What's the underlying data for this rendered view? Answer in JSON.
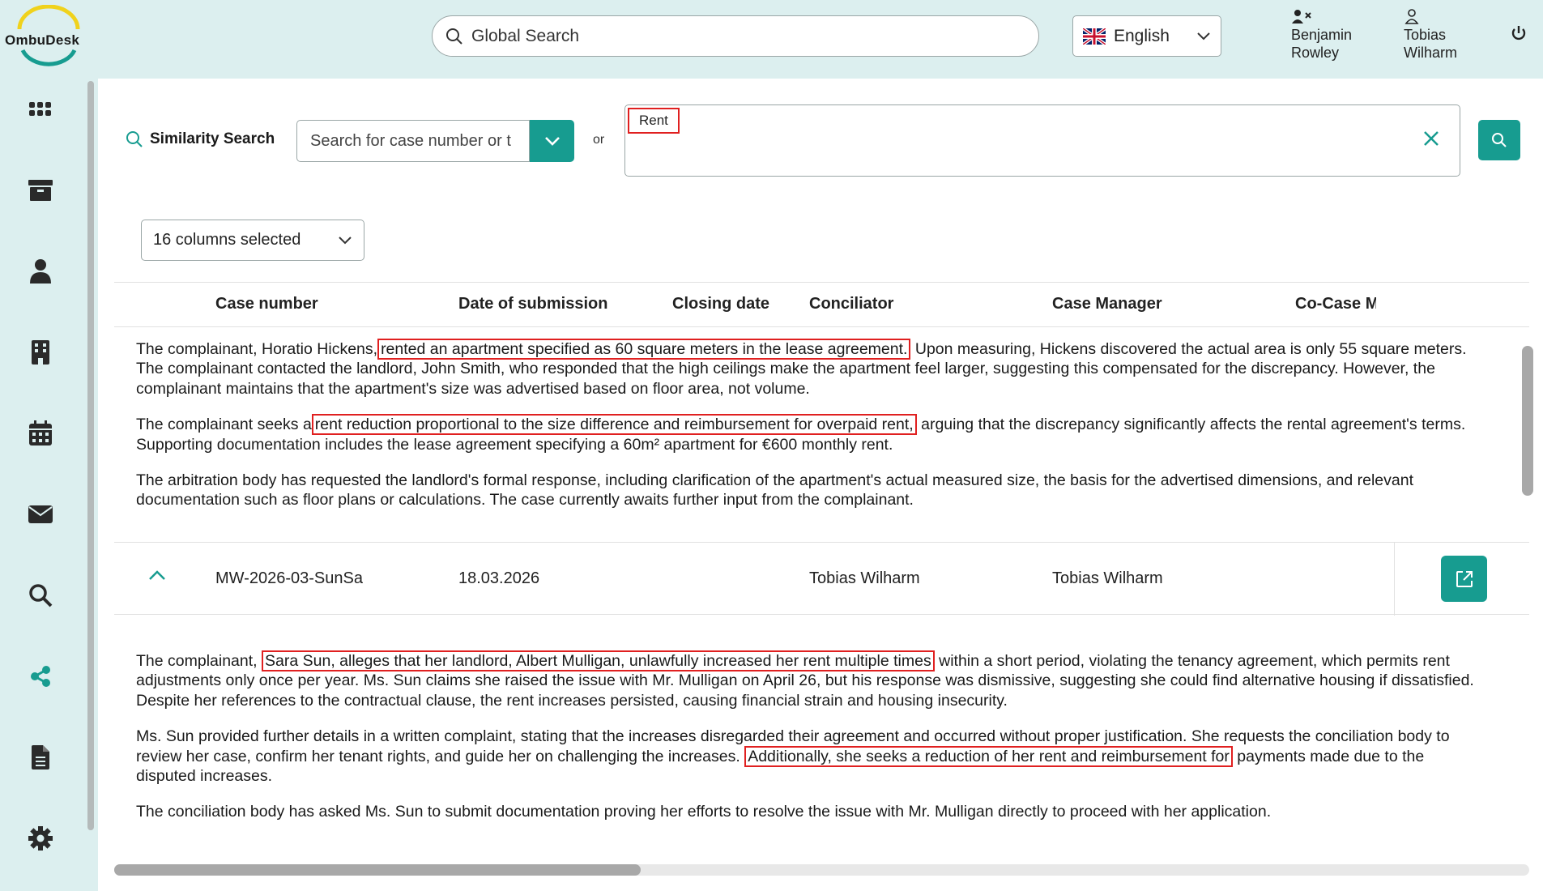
{
  "app": {
    "name": "OmbuDesk"
  },
  "header": {
    "search_placeholder": "Global Search",
    "language": "English",
    "users": [
      {
        "first": "Benjamin",
        "last": "Rowley",
        "icon": "user-x-icon"
      },
      {
        "first": "Tobias",
        "last": "Wilharm",
        "icon": "user-icon"
      }
    ]
  },
  "sidebar": {
    "items": [
      "dashboard-icon",
      "archive-icon",
      "person-icon",
      "building-icon",
      "calendar-icon",
      "mail-icon",
      "search-icon",
      "share-icon",
      "document-icon",
      "gear-icon"
    ],
    "active_color": "#179c90"
  },
  "similarity": {
    "label": "Similarity Search",
    "case_placeholder": "Search for case number or t",
    "or_label": "or",
    "query": "Rent"
  },
  "columns_select": "16 columns selected",
  "table": {
    "headers": [
      "Case number",
      "Date of submission",
      "Closing date",
      "Conciliator",
      "Case Manager",
      "Co-Case M"
    ],
    "desc1": {
      "p1_pre": "The complainant, Horatio Hickens,",
      "p1_hl": "rented an apartment specified as 60 square meters in the lease agreement.",
      "p1_post": " Upon measuring, Hickens discovered the actual area is only 55 square meters. The complainant contacted the landlord, John Smith, who responded that the high ceilings make the apartment feel larger, suggesting this compensated for the discrepancy. However, the complainant maintains that the apartment's size was advertised based on floor area, not volume.",
      "p2_pre": "The complainant seeks a",
      "p2_hl": "rent reduction proportional to the size difference and reimbursement for overpaid rent,",
      "p2_post": " arguing that the discrepancy significantly affects the rental agreement's terms. Supporting documentation includes the lease agreement specifying a 60m² apartment for €600 monthly rent.",
      "p3": "The arbitration body has requested the landlord's formal response, including clarification of the apartment's actual measured size, the basis for the advertised dimensions, and relevant documentation such as floor plans or calculations. The case currently awaits further input from the complainant."
    },
    "row": {
      "case_number": "MW-2026-03-SunSa",
      "date": "18.03.2026",
      "closing": "",
      "conciliator": "Tobias Wilharm",
      "case_manager": "Tobias Wilharm"
    },
    "desc2": {
      "p1_pre": "The complainant,",
      "p1_hl": "Sara Sun, alleges that her landlord, Albert Mulligan, unlawfully increased her rent multiple times",
      "p1_post": " within a short period, violating the tenancy agreement, which permits rent adjustments only once per year. Ms. Sun claims she raised the issue with Mr. Mulligan on April 26, but his response was dismissive, suggesting she could find alternative housing if dissatisfied. Despite her references to the contractual clause, the rent increases persisted, causing financial strain and housing insecurity.",
      "p2_pre": "Ms. Sun provided further details in a written complaint, stating that the increases disregarded their agreement and occurred without proper justification. She requests the conciliation body to review her case, confirm her tenant rights, and guide her on challenging the increases.",
      "p2_hl": "Additionally, she seeks a reduction of her rent and reimbursement for",
      "p2_post": " payments made due to the disputed increases.",
      "p3": "The conciliation body has asked Ms. Sun to submit documentation proving her efforts to resolve the issue with Mr. Mulligan directly to proceed with her application."
    }
  }
}
